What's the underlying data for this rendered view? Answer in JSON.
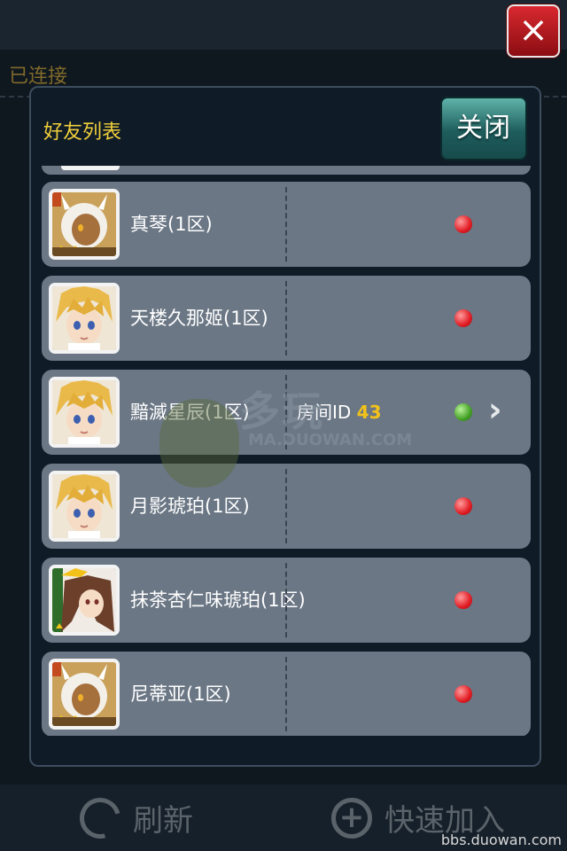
{
  "header": {
    "status_text": "已连接"
  },
  "dialog": {
    "title": "好友列表",
    "close_button_label": "关闭",
    "close_icon": "×"
  },
  "friends": [
    {
      "name": "真琴(1区)",
      "online": false,
      "avatar": "white-hair-girl",
      "status_color": "#e11c24"
    },
    {
      "name": "天楼久那姬(1区)",
      "online": false,
      "avatar": "blonde-boy",
      "status_color": "#e11c24"
    },
    {
      "name": "黯滅星辰(1区)",
      "online": true,
      "avatar": "blonde-boy",
      "status_color": "#45a126",
      "room_label": "房间ID",
      "room_id": "43"
    },
    {
      "name": "月影琥珀(1区)",
      "online": false,
      "avatar": "blonde-boy",
      "status_color": "#e11c24"
    },
    {
      "name": "抹茶杏仁味琥珀(1区)",
      "online": false,
      "avatar": "brown-hair-girl",
      "status_color": "#e11c24"
    },
    {
      "name": "尼蒂亚(1区)",
      "online": false,
      "avatar": "white-hair-girl",
      "status_color": "#e11c24"
    }
  ],
  "bottom_bar": {
    "refresh_label": "刷新",
    "quick_join_label": "快速加入",
    "refresh_icon": "refresh-icon",
    "quick_join_icon": "plus-icon"
  },
  "watermark": {
    "text": "多玩",
    "subtext": "MA.DUOWAN.COM",
    "footer": "bbs.duowan.com"
  },
  "colors": {
    "title": "#f0cf3b",
    "room_id": "#f2c21b",
    "row_bg": "#6b7785",
    "close_button": "#1e5d5c"
  }
}
